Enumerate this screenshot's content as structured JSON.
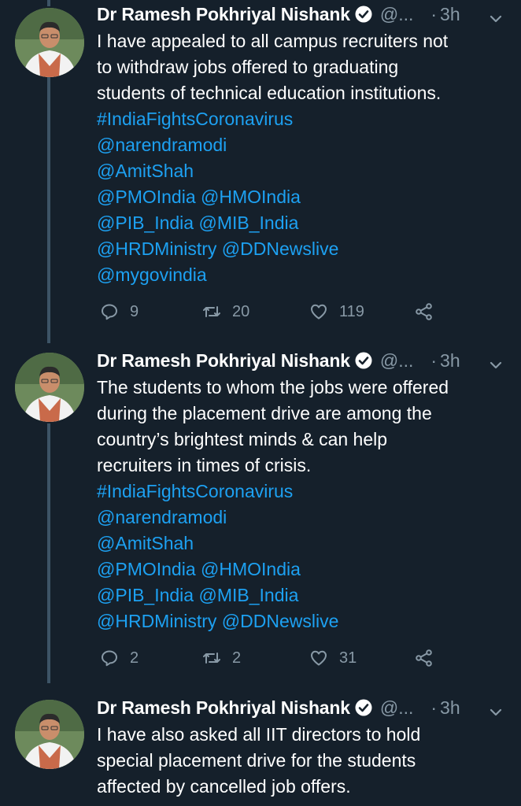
{
  "colors": {
    "background": "#15202b",
    "text": "#ffffff",
    "muted": "#8899a6",
    "link": "#1da1f2",
    "thread_line": "#3d5466"
  },
  "tweets": [
    {
      "author_name": "Dr Ramesh Pokhriyal Nishank",
      "handle": "@...",
      "dot": "·",
      "time": "3h",
      "lines": [
        {
          "text": "I have appealed to all campus recruiters not",
          "link": false
        },
        {
          "text": "to withdraw jobs offered to graduating",
          "link": false
        },
        {
          "text": "students of technical education institutions.",
          "link": false
        },
        {
          "text": "#IndiaFightsCoronavirus",
          "link": true
        },
        {
          "text": "@narendramodi",
          "link": true
        },
        {
          "text": "@AmitShah",
          "link": true
        },
        {
          "text": "@PMOIndia @HMOIndia",
          "link": true
        },
        {
          "text": "@PIB_India @MIB_India",
          "link": true
        },
        {
          "text": "@HRDMinistry @DDNewslive",
          "link": true
        },
        {
          "text": "@mygovindia",
          "link": true
        }
      ],
      "replies": "9",
      "retweets": "20",
      "likes": "119"
    },
    {
      "author_name": "Dr Ramesh Pokhriyal Nishank",
      "handle": "@...",
      "dot": "·",
      "time": "3h",
      "lines": [
        {
          "text": "The students to whom the jobs were offered",
          "link": false
        },
        {
          "text": "during the placement drive are among the",
          "link": false
        },
        {
          "text": "country’s brightest minds & can help",
          "link": false
        },
        {
          "text": "recruiters in times of crisis.",
          "link": false
        },
        {
          "text": "#IndiaFightsCoronavirus",
          "link": true
        },
        {
          "text": "@narendramodi",
          "link": true
        },
        {
          "text": "@AmitShah",
          "link": true
        },
        {
          "text": "@PMOIndia @HMOIndia",
          "link": true
        },
        {
          "text": "@PIB_India @MIB_India",
          "link": true
        },
        {
          "text": "@HRDMinistry @DDNewslive",
          "link": true
        }
      ],
      "replies": "2",
      "retweets": "2",
      "likes": "31"
    },
    {
      "author_name": "Dr Ramesh Pokhriyal Nishank",
      "handle": "@...",
      "dot": "·",
      "time": "3h",
      "lines": [
        {
          "text": "I have also asked all IIT directors to hold",
          "link": false
        },
        {
          "text": "special placement drive for the students",
          "link": false
        },
        {
          "text": "affected by cancelled job offers.",
          "link": false
        }
      ]
    }
  ]
}
